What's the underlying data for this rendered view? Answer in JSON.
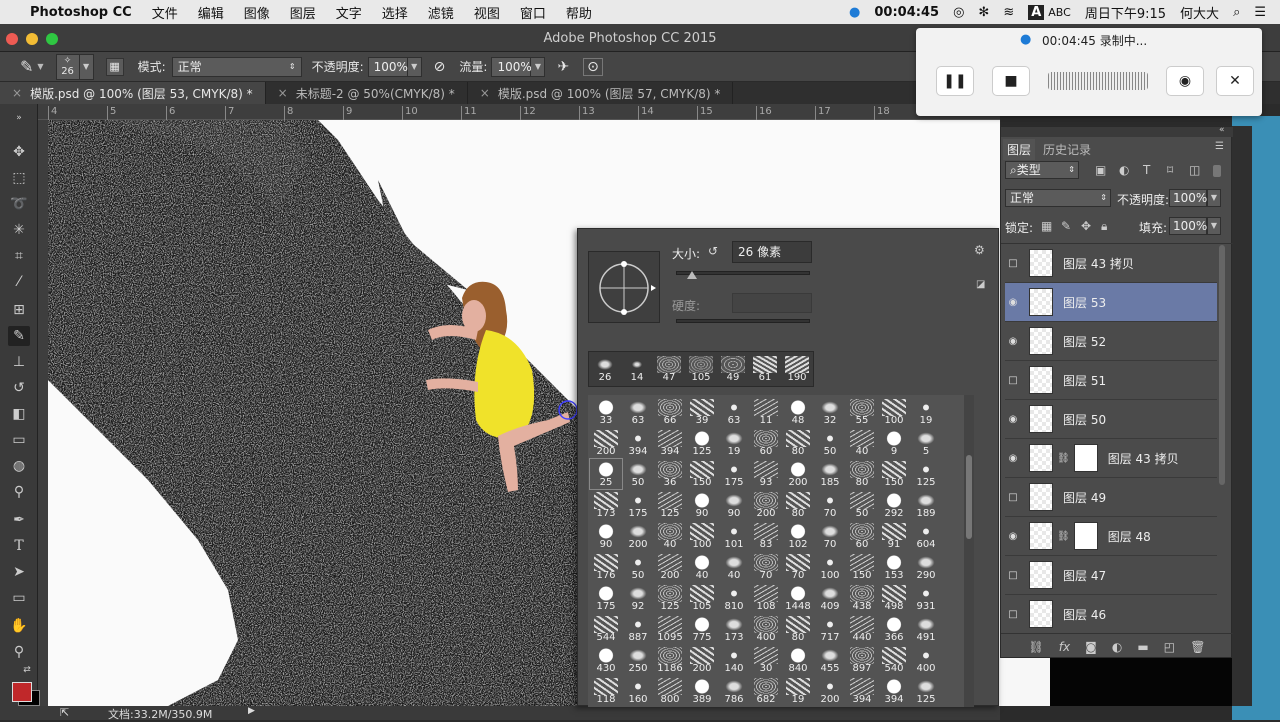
{
  "menubar": {
    "app_name": "Photoshop CC",
    "items": [
      "文件",
      "编辑",
      "图像",
      "图层",
      "文字",
      "选择",
      "滤镜",
      "视图",
      "窗口",
      "帮助"
    ],
    "clock_timer": "00:04:45",
    "input_method": "ABC",
    "datetime": "周日下午9:15",
    "user": "何大大"
  },
  "window": {
    "title": "Adobe Photoshop CC 2015"
  },
  "options": {
    "brush_size": "26",
    "mode_label": "模式:",
    "mode_value": "正常",
    "opacity_label": "不透明度:",
    "opacity_value": "100%",
    "flow_label": "流量:",
    "flow_value": "100%"
  },
  "tabs": [
    {
      "label": "模版.psd @ 100% (图层 53, CMYK/8) *",
      "active": true
    },
    {
      "label": "未标题-2 @ 50%(CMYK/8) *",
      "active": false
    },
    {
      "label": "模版.psd @ 100% (图层 57, CMYK/8) *",
      "active": false
    }
  ],
  "ruler_ticks": [
    "4",
    "5",
    "6",
    "7",
    "8",
    "9",
    "10",
    "11",
    "12",
    "13",
    "14",
    "15",
    "16",
    "17",
    "18"
  ],
  "status": {
    "doc_size": "文档:33.2M/350.9M"
  },
  "recorder": {
    "status_text": "00:04:45 录制中..."
  },
  "brush_picker": {
    "size_label": "大小:",
    "size_value": "26 像素",
    "hardness_label": "硬度:",
    "recent_brushes": [
      "26",
      "14",
      "47",
      "105",
      "49",
      "61",
      "190"
    ],
    "grid_rows": [
      [
        "33",
        "63",
        "66",
        "39",
        "63",
        "11",
        "48",
        "32",
        "55",
        "100",
        "19"
      ],
      [
        "200",
        "394",
        "394",
        "125",
        "19",
        "60",
        "80",
        "50",
        "40",
        "9",
        "5"
      ],
      [
        "25",
        "50",
        "36",
        "150",
        "175",
        "93",
        "200",
        "185",
        "80",
        "150",
        "125"
      ],
      [
        "173",
        "175",
        "125",
        "90",
        "90",
        "200",
        "80",
        "70",
        "50",
        "292",
        "189"
      ],
      [
        "90",
        "200",
        "40",
        "100",
        "101",
        "83",
        "102",
        "70",
        "60",
        "91",
        "604"
      ],
      [
        "176",
        "50",
        "200",
        "40",
        "40",
        "70",
        "70",
        "100",
        "150",
        "153",
        "290"
      ],
      [
        "175",
        "92",
        "125",
        "105",
        "810",
        "108",
        "1448",
        "409",
        "438",
        "498",
        "931"
      ],
      [
        "544",
        "887",
        "1095",
        "775",
        "173",
        "400",
        "80",
        "717",
        "440",
        "366",
        "491"
      ],
      [
        "430",
        "250",
        "1186",
        "200",
        "140",
        "30",
        "840",
        "455",
        "897",
        "540",
        "400"
      ],
      [
        "118",
        "160",
        "800",
        "389",
        "786",
        "682",
        "19",
        "200",
        "394",
        "394",
        "125"
      ]
    ]
  },
  "layers_panel": {
    "tabs": [
      "图层",
      "历史记录"
    ],
    "filter_label": "类型",
    "blend_mode": "正常",
    "opacity_label": "不透明度:",
    "opacity_value": "100%",
    "lock_label": "锁定:",
    "fill_label": "填充:",
    "fill_value": "100%",
    "layers": [
      {
        "name": "图层 43 拷贝",
        "visible": false,
        "selected": false
      },
      {
        "name": "图层 53",
        "visible": true,
        "selected": true
      },
      {
        "name": "图层 52",
        "visible": true,
        "selected": false
      },
      {
        "name": "图层 51",
        "visible": false,
        "selected": false
      },
      {
        "name": "图层 50",
        "visible": true,
        "selected": false
      },
      {
        "name": "图层 43 拷贝",
        "visible": true,
        "selected": false,
        "masked": true
      },
      {
        "name": "图层 49",
        "visible": false,
        "selected": false
      },
      {
        "name": "图层 48",
        "visible": true,
        "selected": false,
        "masked": true
      },
      {
        "name": "图层 47",
        "visible": false,
        "selected": false
      },
      {
        "name": "图层 46",
        "visible": false,
        "selected": false
      }
    ]
  },
  "colors": {
    "foreground": "#c0282a",
    "background": "#000000",
    "selected_layer": "#6a7aa6"
  }
}
